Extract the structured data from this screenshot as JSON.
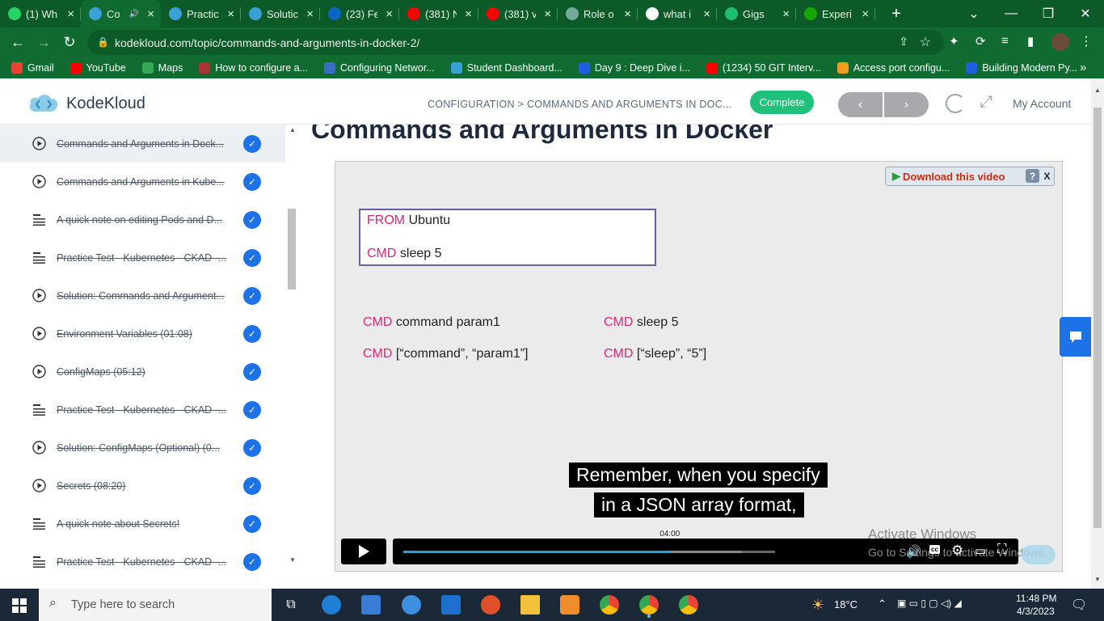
{
  "browser": {
    "tabs": [
      {
        "label": "(1) Wh",
        "icon": "whatsapp-icon",
        "color": "#25d366"
      },
      {
        "label": "Co",
        "icon": "kodekloud-icon",
        "color": "#3aa0d8",
        "active": true
      },
      {
        "label": "Practic",
        "icon": "kodekloud-icon",
        "color": "#3aa0d8"
      },
      {
        "label": "Solutic",
        "icon": "kodekloud-icon",
        "color": "#3aa0d8"
      },
      {
        "label": "(23) Fe",
        "icon": "linkedin-icon",
        "color": "#0a66c2"
      },
      {
        "label": "(381) N",
        "icon": "youtube-icon",
        "color": "#ff0000"
      },
      {
        "label": "(381) v",
        "icon": "youtube-icon",
        "color": "#ff0000"
      },
      {
        "label": "Role o",
        "icon": "chatgpt-icon",
        "color": "#74aa9c"
      },
      {
        "label": "what i",
        "icon": "google-icon",
        "color": "#ffffff"
      },
      {
        "label": "Gigs",
        "icon": "fiverr-icon",
        "color": "#1dbf73"
      },
      {
        "label": "Experi",
        "icon": "upwork-icon",
        "color": "#14a800"
      }
    ],
    "new_tab": "+",
    "url": "kodekloud.com/topic/commands-and-arguments-in-docker-2/",
    "bookmarks": [
      {
        "label": "Gmail",
        "icon": "gmail-icon",
        "color": "#ea4335"
      },
      {
        "label": "YouTube",
        "icon": "youtube-icon",
        "color": "#ff0000"
      },
      {
        "label": "Maps",
        "icon": "maps-icon",
        "color": "#34a853"
      },
      {
        "label": "How to configure a...",
        "icon": "page-icon",
        "color": "#a33"
      },
      {
        "label": "Configuring Networ...",
        "icon": "vmware-icon",
        "color": "#3b6ec2"
      },
      {
        "label": "Student Dashboard...",
        "icon": "kodekloud-icon",
        "color": "#3aa0d8"
      },
      {
        "label": "Day 9 : Deep Dive i...",
        "icon": "diamond-icon",
        "color": "#1d5fe0"
      },
      {
        "label": "(1234) 50 GIT Interv...",
        "icon": "youtube-icon",
        "color": "#ff0000"
      },
      {
        "label": "Access port configu...",
        "icon": "page-icon",
        "color": "#f29b1d"
      },
      {
        "label": "Building Modern Py...",
        "icon": "c-icon",
        "color": "#1d5fe0"
      }
    ],
    "bookmarks_more": "»"
  },
  "site": {
    "logo": "KodeKloud",
    "breadcrumb": "CONFIGURATION > COMMANDS AND ARGUMENTS IN DOC...",
    "complete_label": "Complete",
    "prev_label": "‹",
    "next_label": "›",
    "account_label": "My Account"
  },
  "sidebar": {
    "items": [
      {
        "label": "Commands and Arguments in Dock...",
        "type": "video",
        "done": true,
        "current": true
      },
      {
        "label": "Commands and Arguments in Kube...",
        "type": "video",
        "done": true
      },
      {
        "label": "A quick note on editing Pods and D...",
        "type": "text",
        "done": true
      },
      {
        "label": "Practice Test - Kubernetes - CKAD -...",
        "type": "text",
        "done": true
      },
      {
        "label": "Solution: Commands and Argument...",
        "type": "video",
        "done": true
      },
      {
        "label": "Environment Variables (01:08)",
        "type": "video",
        "done": true
      },
      {
        "label": "ConfigMaps (05:12)",
        "type": "video",
        "done": true
      },
      {
        "label": "Practice Test - Kubernetes - CKAD -...",
        "type": "text",
        "done": true
      },
      {
        "label": "Solution: ConfigMaps (Optional) (0...",
        "type": "video",
        "done": true
      },
      {
        "label": "Secrets (08:20)",
        "type": "video",
        "done": true
      },
      {
        "label": "A quick note about Secrets!",
        "type": "text",
        "done": true
      },
      {
        "label": "Practice Test - Kubernetes - CKAD -...",
        "type": "text",
        "done": true
      }
    ]
  },
  "lesson": {
    "title": "Commands and Arguments in Docker",
    "download_label": "Download this video",
    "help_label": "?",
    "close_label": "X",
    "slide": {
      "box_line1_kw": "FROM",
      "box_line1_val": "Ubuntu",
      "box_line2_kw": "CMD",
      "box_line2_val": "sleep 5",
      "left1_kw": "CMD",
      "left1_val": "command param1",
      "left2_kw": "CMD",
      "left2_val": "[“command”, “param1”]",
      "right1_kw": "CMD",
      "right1_val": "sleep 5",
      "right2_kw": "CMD",
      "right2_val": "[“sleep”, “5”]"
    },
    "subtitle_line1": "Remember, when you specify",
    "subtitle_line2": "in a JSON array format,",
    "time_tooltip": "04:00",
    "progress": 0.72,
    "buffered": 0.91,
    "watermark_line1": "Activate Windows",
    "watermark_line2": "Go to Settings to activate Windows."
  },
  "taskbar": {
    "search_placeholder": "Type here to search",
    "temperature": "18°C",
    "time": "11:48 PM",
    "date": "4/3/2023"
  }
}
